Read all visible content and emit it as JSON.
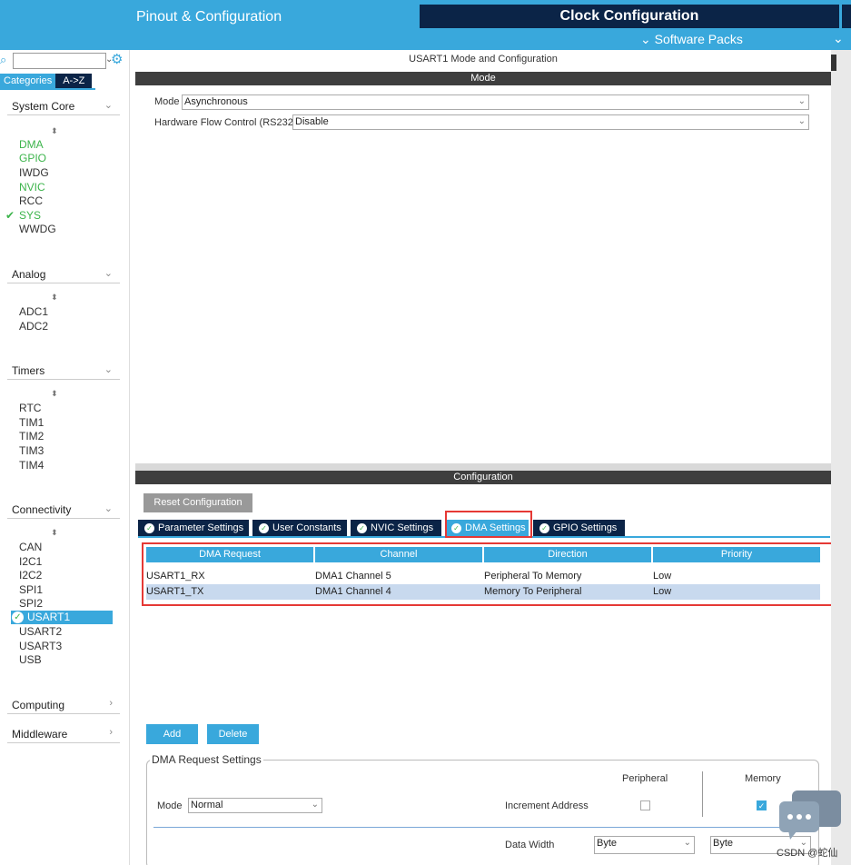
{
  "header": {
    "pinout_tab": "Pinout & Configuration",
    "clock_tab": "Clock Configuration",
    "software_packs": "Software Packs",
    "packs_chevron": "⌄"
  },
  "sidebar": {
    "categories_tab": "Categories",
    "az_tab": "A->Z",
    "groups": [
      {
        "name": "System Core",
        "items": [
          "DMA",
          "GPIO",
          "IWDG",
          "NVIC",
          "RCC",
          "SYS",
          "WWDG"
        ]
      },
      {
        "name": "Analog",
        "items": [
          "ADC1",
          "ADC2"
        ]
      },
      {
        "name": "Timers",
        "items": [
          "RTC",
          "TIM1",
          "TIM2",
          "TIM3",
          "TIM4"
        ]
      },
      {
        "name": "Connectivity",
        "items": [
          "CAN",
          "I2C1",
          "I2C2",
          "SPI1",
          "SPI2",
          "USART1",
          "USART2",
          "USART3",
          "USB"
        ]
      },
      {
        "name": "Computing",
        "items": []
      },
      {
        "name": "Middleware",
        "items": []
      }
    ]
  },
  "main": {
    "title": "USART1 Mode and Configuration",
    "mode_bar": "Mode",
    "mode_label": "Mode",
    "mode_value": "Asynchronous",
    "hwflow_label": "Hardware Flow Control (RS232)",
    "hwflow_value": "Disable",
    "config_bar": "Configuration",
    "reset_button": "Reset Configuration",
    "tabs": [
      "Parameter Settings",
      "User Constants",
      "NVIC Settings",
      "DMA Settings",
      "GPIO Settings"
    ],
    "table": {
      "headers": [
        "DMA Request",
        "Channel",
        "Direction",
        "Priority"
      ],
      "rows": [
        [
          "USART1_RX",
          "DMA1 Channel 5",
          "Peripheral To Memory",
          "Low"
        ],
        [
          "USART1_TX",
          "DMA1 Channel 4",
          "Memory To Peripheral",
          "Low"
        ]
      ]
    },
    "add_button": "Add",
    "delete_button": "Delete",
    "dma_settings": {
      "legend": "DMA Request Settings",
      "peripheral_label": "Peripheral",
      "memory_label": "Memory",
      "mode_label": "Mode",
      "mode_value": "Normal",
      "increment_label": "Increment Address",
      "data_width_label": "Data Width",
      "peripheral_width": "Byte",
      "memory_width": "Byte"
    }
  },
  "watermark": "CSDN @蛇仙"
}
